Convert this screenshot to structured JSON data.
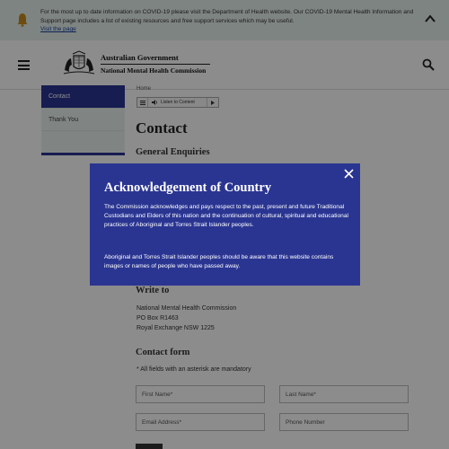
{
  "alert": {
    "message": "For the most up to date information on COVID-19 please visit the Department of Health website. Our COVID-19 Mental Health Information and Support page includes a list of existing resources and free support services which may be useful.",
    "link": "Visit the page",
    "icon": "bell-icon",
    "toggle_icon": "chevron-up-icon"
  },
  "header": {
    "logo_line1": "Australian Government",
    "logo_line2": "National Mental Health Commission",
    "menu_icon": "hamburger-menu-icon",
    "search_icon": "search-icon"
  },
  "sidebar": {
    "items": [
      {
        "label": "Contact"
      },
      {
        "label": "Thank You"
      }
    ]
  },
  "main": {
    "breadcrumb": "Home",
    "listen_label": "Listen to Content",
    "title": "Contact",
    "general_enquiries": "General Enquiries",
    "write_to": "Write to",
    "address": [
      "National Mental Health Commission",
      "PO Box R1463",
      "Royal Exchange NSW 1225"
    ],
    "contact_form": "Contact form",
    "mandatory_note": "* All fields with an asterisk are mandatory",
    "fields": {
      "first_name": "First Name*",
      "last_name": "Last Name*",
      "email": "Email Address*",
      "phone": "Phone Number"
    }
  },
  "modal": {
    "title": "Acknowledgement of Country",
    "p1": "The Commission acknowledges and pays respect to the past, present and future Traditional Custodians and Elders of this nation and the continuation of cultural, spiritual and educational practices of Aboriginal and Torres Strait Islander peoples.",
    "p2": "Aboriginal and Torres Strait Islander peoples should be aware that this website contains images or names of people who have passed away.",
    "close_icon": "close-icon"
  },
  "colors": {
    "brand_blue": "#2a3592",
    "alert_bg": "#e6f0ec",
    "alert_icon": "#c98a1e"
  }
}
